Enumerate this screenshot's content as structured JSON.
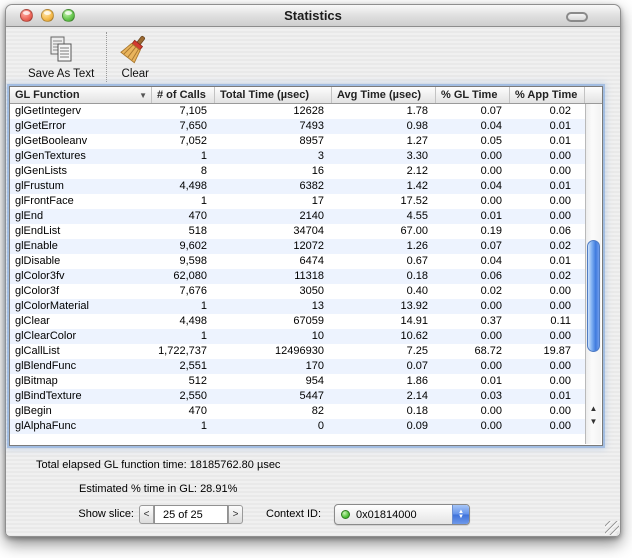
{
  "window": {
    "title": "Statistics"
  },
  "toolbar": {
    "items": [
      {
        "label": "Save As Text",
        "icon": "save-as-text-icon"
      },
      {
        "label": "Clear",
        "icon": "clear-icon"
      }
    ]
  },
  "table": {
    "columns": [
      {
        "label": "GL Function",
        "sort": "desc"
      },
      {
        "label": "# of Calls"
      },
      {
        "label": "Total Time (µsec)"
      },
      {
        "label": "Avg Time (µsec)"
      },
      {
        "label": "% GL Time"
      },
      {
        "label": "% App Time"
      }
    ],
    "rows": [
      [
        "glGetIntegerv",
        "7,105",
        "12628",
        "1.78",
        "0.07",
        "0.02"
      ],
      [
        "glGetError",
        "7,650",
        "7493",
        "0.98",
        "0.04",
        "0.01"
      ],
      [
        "glGetBooleanv",
        "7,052",
        "8957",
        "1.27",
        "0.05",
        "0.01"
      ],
      [
        "glGenTextures",
        "1",
        "3",
        "3.30",
        "0.00",
        "0.00"
      ],
      [
        "glGenLists",
        "8",
        "16",
        "2.12",
        "0.00",
        "0.00"
      ],
      [
        "glFrustum",
        "4,498",
        "6382",
        "1.42",
        "0.04",
        "0.01"
      ],
      [
        "glFrontFace",
        "1",
        "17",
        "17.52",
        "0.00",
        "0.00"
      ],
      [
        "glEnd",
        "470",
        "2140",
        "4.55",
        "0.01",
        "0.00"
      ],
      [
        "glEndList",
        "518",
        "34704",
        "67.00",
        "0.19",
        "0.06"
      ],
      [
        "glEnable",
        "9,602",
        "12072",
        "1.26",
        "0.07",
        "0.02"
      ],
      [
        "glDisable",
        "9,598",
        "6474",
        "0.67",
        "0.04",
        "0.01"
      ],
      [
        "glColor3fv",
        "62,080",
        "11318",
        "0.18",
        "0.06",
        "0.02"
      ],
      [
        "glColor3f",
        "7,676",
        "3050",
        "0.40",
        "0.02",
        "0.00"
      ],
      [
        "glColorMaterial",
        "1",
        "13",
        "13.92",
        "0.00",
        "0.00"
      ],
      [
        "glClear",
        "4,498",
        "67059",
        "14.91",
        "0.37",
        "0.11"
      ],
      [
        "glClearColor",
        "1",
        "10",
        "10.62",
        "0.00",
        "0.00"
      ],
      [
        "glCallList",
        "1,722,737",
        "12496930",
        "7.25",
        "68.72",
        "19.87"
      ],
      [
        "glBlendFunc",
        "2,551",
        "170",
        "0.07",
        "0.00",
        "0.00"
      ],
      [
        "glBitmap",
        "512",
        "954",
        "1.86",
        "0.01",
        "0.00"
      ],
      [
        "glBindTexture",
        "2,550",
        "5447",
        "2.14",
        "0.03",
        "0.01"
      ],
      [
        "glBegin",
        "470",
        "82",
        "0.18",
        "0.00",
        "0.00"
      ],
      [
        "glAlphaFunc",
        "1",
        "0",
        "0.09",
        "0.00",
        "0.00"
      ]
    ]
  },
  "footer": {
    "total_time_label": "Total elapsed GL function time:",
    "total_time_value": "18185762.80 µsec",
    "gl_percent_label": "Estimated % time in GL:",
    "gl_percent_value": "28.91%",
    "show_slice_label": "Show slice:",
    "slice_prev": "<",
    "slice_value": "25 of 25",
    "slice_next": ">",
    "context_id_label": "Context ID:",
    "context_id_value": "0x01814000"
  },
  "colors": {
    "row_stripe": "#edf3fe",
    "scrollbar_thumb_blue": "#3f7bde",
    "focus_ring_blue": "#7da5dc",
    "traffic_red": "#ee6a5e",
    "traffic_yellow": "#f6bd4f",
    "traffic_green": "#6bca53",
    "context_status_green": "#2ea524"
  }
}
